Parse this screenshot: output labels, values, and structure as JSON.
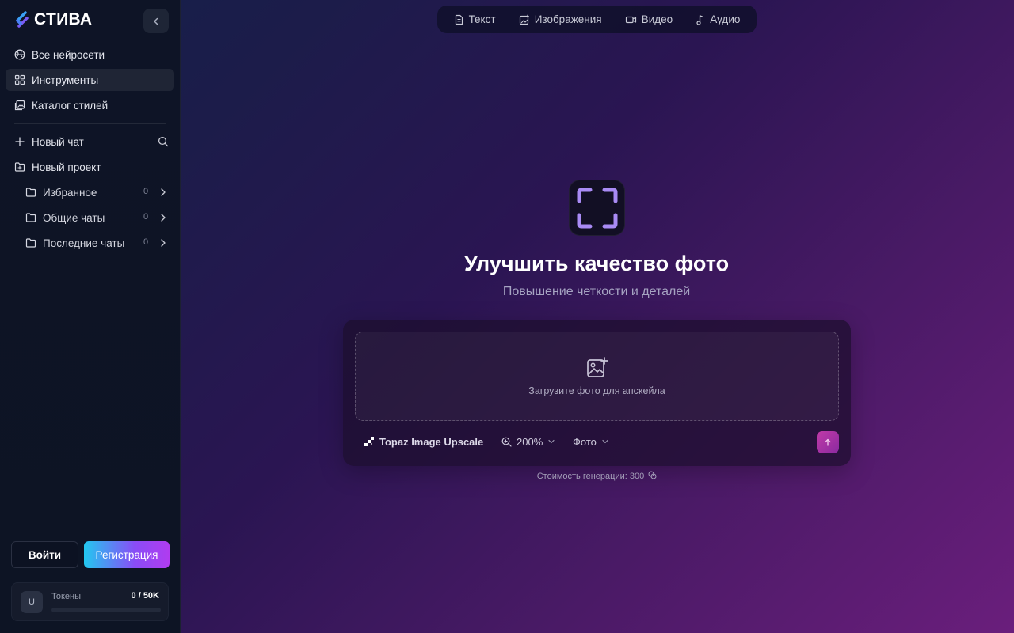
{
  "brand": {
    "name": "СТИВА"
  },
  "sidebar": {
    "nav": [
      {
        "label": "Все нейросети",
        "icon": "globe-icon"
      },
      {
        "label": "Инструменты",
        "icon": "grid-icon",
        "active": true
      },
      {
        "label": "Каталог стилей",
        "icon": "gallery-icon"
      }
    ],
    "new_chat": "Новый чат",
    "new_project": "Новый проект",
    "folders": [
      {
        "label": "Избранное",
        "count": "0"
      },
      {
        "label": "Общие чаты",
        "count": "0"
      },
      {
        "label": "Последние чаты",
        "count": "0"
      }
    ],
    "login": "Войти",
    "register": "Регистрация",
    "tokens": {
      "avatar": "U",
      "label": "Токены",
      "value": "0 / 50K",
      "progress": 0
    }
  },
  "topbar": {
    "tabs": [
      {
        "label": "Текст",
        "icon": "document-icon"
      },
      {
        "label": "Изображения",
        "icon": "image-icon"
      },
      {
        "label": "Видео",
        "icon": "video-icon"
      },
      {
        "label": "Аудио",
        "icon": "music-icon"
      }
    ]
  },
  "hero": {
    "icon": "frame-corners-icon",
    "title": "Улучшить качество фото",
    "subtitle": "Повышение четкости и деталей"
  },
  "panel": {
    "dropzone_text": "Загрузите фото для апскейла",
    "model": "Topaz Image Upscale",
    "scale": "200%",
    "type": "Фото",
    "cost": "Стоимость генерации: 300"
  },
  "colors": {
    "accent_gradient_start": "#22c8f0",
    "accent_gradient_end": "#b03cf0",
    "send_button": "#c13aa8",
    "hero_icon": "#a98bf5"
  }
}
